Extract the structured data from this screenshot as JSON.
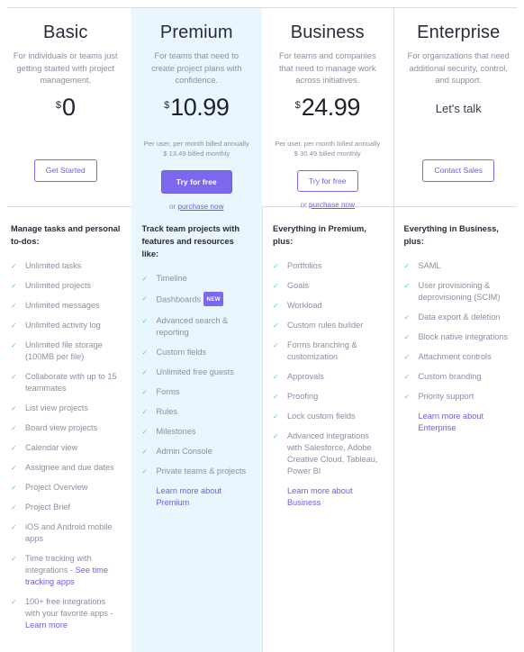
{
  "icons": {
    "check": "✓"
  },
  "colors": {
    "accent": "#7b68ee",
    "link": "#6c5ce7",
    "check": "#4ecdc4",
    "highlight_bg": "#eaf6fd",
    "muted_text": "#8a8fa3",
    "heading_text": "#2b2b3a",
    "divider": "#d8dce3"
  },
  "plans": [
    {
      "name": "Basic",
      "description": "For individuals or teams just getting started with project management.",
      "currency": "$",
      "price": "0",
      "price_text": "",
      "billing_annual": "",
      "billing_monthly": "",
      "cta_label": "Get Started",
      "cta_style": "outline",
      "purchase_prefix": "",
      "purchase_link": "",
      "highlight": false,
      "features_title": "Manage tasks and personal to-dos:",
      "features": [
        {
          "text": "Unlimited tasks"
        },
        {
          "text": "Unlimited projects"
        },
        {
          "text": "Unlimited messages"
        },
        {
          "text": "Unlimited activity log"
        },
        {
          "text": "Unlimited file storage (100MB per file)"
        },
        {
          "text": "Collaborate with up to 15 teammates"
        },
        {
          "text": "List view projects"
        },
        {
          "text": "Board view projects"
        },
        {
          "text": "Calendar view"
        },
        {
          "text": "Assignee and due dates"
        },
        {
          "text": "Project Overview"
        },
        {
          "text": "Project Brief"
        },
        {
          "text": "iOS and Android mobile apps"
        },
        {
          "text": "Time tracking with integrations - ",
          "link": "See time tracking apps"
        },
        {
          "text": "100+ free integrations with your favorite apps - ",
          "link": "Learn more"
        }
      ],
      "learn_more": ""
    },
    {
      "name": "Premium",
      "description": "For teams that need to create project plans with confidence.",
      "currency": "$",
      "price": "10.99",
      "price_text": "",
      "billing_annual": "Per user, per month billed annually",
      "billing_monthly": "$ 13.49 billed monthly",
      "cta_label": "Try for free",
      "cta_style": "filled",
      "purchase_prefix": "or ",
      "purchase_link": "purchase now",
      "highlight": true,
      "features_title": "Track team projects with features and resources like:",
      "features": [
        {
          "text": "Timeline"
        },
        {
          "text": "Dashboards",
          "badge": "NEW"
        },
        {
          "text": "Advanced search & reporting"
        },
        {
          "text": "Custom fields"
        },
        {
          "text": "Unlimited free guests"
        },
        {
          "text": "Forms"
        },
        {
          "text": "Rules"
        },
        {
          "text": "Milestones"
        },
        {
          "text": "Admin Console"
        },
        {
          "text": "Private teams & projects"
        }
      ],
      "learn_more": "Learn more about Premium"
    },
    {
      "name": "Business",
      "description": "For teams and companies that need to manage work across initiatives.",
      "currency": "$",
      "price": "24.99",
      "price_text": "",
      "billing_annual": "Per user, per month billed annually",
      "billing_monthly": "$ 30.49 billed monthly",
      "cta_label": "Try for free",
      "cta_style": "outline",
      "purchase_prefix": "or ",
      "purchase_link": "purchase now",
      "highlight": false,
      "features_title": "Everything in Premium, plus:",
      "features": [
        {
          "text": "Portfolios"
        },
        {
          "text": "Goals"
        },
        {
          "text": "Workload"
        },
        {
          "text": "Custom rules builder"
        },
        {
          "text": "Forms branching & customization"
        },
        {
          "text": "Approvals"
        },
        {
          "text": "Proofing"
        },
        {
          "text": "Lock custom fields"
        },
        {
          "text": "Advanced integrations with Salesforce, Adobe Creative Cloud, Tableau, Power BI"
        }
      ],
      "learn_more": "Learn more about Business"
    },
    {
      "name": "Enterprise",
      "description": "For organizations that need additional security, control, and support.",
      "currency": "",
      "price": "",
      "price_text": "Let's talk",
      "billing_annual": "",
      "billing_monthly": "",
      "cta_label": "Contact Sales",
      "cta_style": "outline",
      "purchase_prefix": "",
      "purchase_link": "",
      "highlight": false,
      "features_title": "Everything in Business, plus:",
      "features": [
        {
          "text": "SAML"
        },
        {
          "text": "User provisioning & deprovisioning (SCIM)"
        },
        {
          "text": "Data export & deletion"
        },
        {
          "text": "Block native integrations"
        },
        {
          "text": "Attachment controls"
        },
        {
          "text": "Custom branding"
        },
        {
          "text": "Priority support"
        }
      ],
      "learn_more": "Learn more about Enterprise"
    }
  ]
}
